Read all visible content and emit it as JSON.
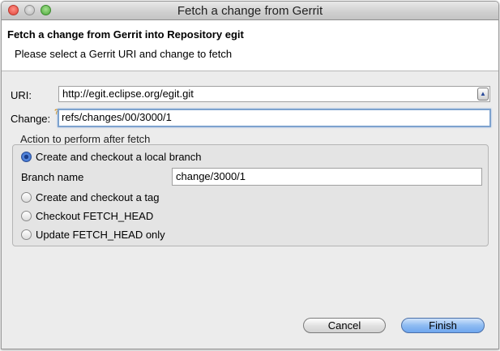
{
  "window": {
    "title": "Fetch a change from Gerrit"
  },
  "header": {
    "title": "Fetch a change from Gerrit into Repository egit",
    "description": "Please select a Gerrit URI and change to fetch"
  },
  "form": {
    "uri_label": "URI:",
    "uri_value": "http://egit.eclipse.org/egit.git",
    "change_label": "Change:",
    "change_value": "refs/changes/00/3000/1"
  },
  "action_group": {
    "title": "Action to perform after fetch",
    "options": [
      {
        "label": "Create and checkout a local branch",
        "selected": true
      },
      {
        "label": "Create and checkout a tag",
        "selected": false
      },
      {
        "label": "Checkout FETCH_HEAD",
        "selected": false
      },
      {
        "label": "Update FETCH_HEAD only",
        "selected": false
      }
    ],
    "branch_name_label": "Branch name",
    "branch_name_value": "change/3000/1"
  },
  "buttons": {
    "cancel": "Cancel",
    "finish": "Finish"
  },
  "colors": {
    "default_button": "#8fbcf2",
    "focus_ring": "#7da2ce",
    "close": "#e0443a",
    "maximize": "#4aa63a"
  }
}
